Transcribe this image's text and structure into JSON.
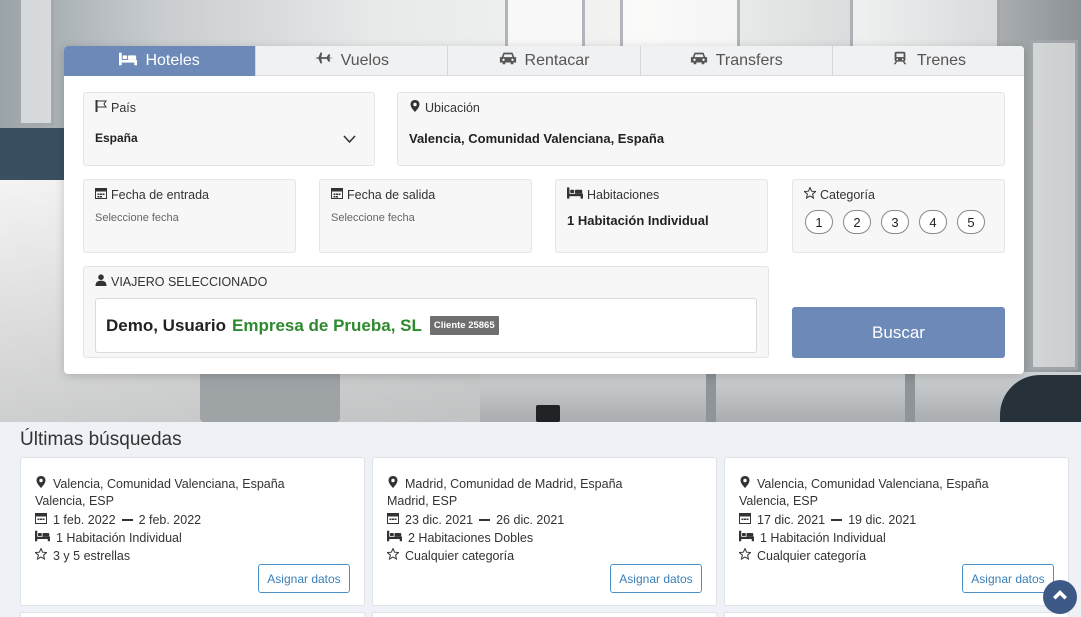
{
  "tabs": [
    {
      "label": "Hoteles",
      "icon": "bed-icon",
      "active": true
    },
    {
      "label": "Vuelos",
      "icon": "plane-icon",
      "active": false
    },
    {
      "label": "Rentacar",
      "icon": "car-icon",
      "active": false
    },
    {
      "label": "Transfers",
      "icon": "car-icon",
      "active": false
    },
    {
      "label": "Trenes",
      "icon": "train-icon",
      "active": false
    }
  ],
  "form": {
    "country": {
      "label": "País",
      "value": "España"
    },
    "location": {
      "label": "Ubicación",
      "value": "Valencia, Comunidad Valenciana, España"
    },
    "checkin": {
      "label": "Fecha de entrada",
      "placeholder": "Seleccione fecha"
    },
    "checkout": {
      "label": "Fecha de salida",
      "placeholder": "Seleccione fecha"
    },
    "rooms": {
      "label": "Habitaciones",
      "value": "1 Habitación Individual"
    },
    "category": {
      "label": "Categoría",
      "options": [
        "1",
        "2",
        "3",
        "4",
        "5"
      ]
    },
    "traveler": {
      "label": "VIAJERO SELECCIONADO",
      "name": "Demo, Usuario",
      "company": "Empresa de Prueba, SL",
      "badge": "Cliente 25865"
    },
    "search_label": "Buscar"
  },
  "recent": {
    "title": "Últimas búsquedas",
    "assign_label": "Asignar datos",
    "items": [
      {
        "location": "Valencia, Comunidad Valenciana, España",
        "city": "Valencia, ESP",
        "dates_from": "1 feb. 2022",
        "dates_to": "2 feb. 2022",
        "rooms": "1 Habitación Individual",
        "category": "3 y 5 estrellas"
      },
      {
        "location": "Madrid, Comunidad de Madrid, España",
        "city": "Madrid, ESP",
        "dates_from": "23 dic. 2021",
        "dates_to": "26 dic. 2021",
        "rooms": "2 Habitaciones Dobles",
        "category": "Cualquier categoría"
      },
      {
        "location": "Valencia, Comunidad Valenciana, España",
        "city": "Valencia, ESP",
        "dates_from": "17 dic. 2021",
        "dates_to": "19 dic. 2021",
        "rooms": "1 Habitación Individual",
        "category": "Cualquier categoría"
      }
    ]
  },
  "colors": {
    "accent": "#6d89b8",
    "company_green": "#2d8a2d",
    "button_blue": "#3a7fb8",
    "scroll_top": "#3d5a86"
  }
}
